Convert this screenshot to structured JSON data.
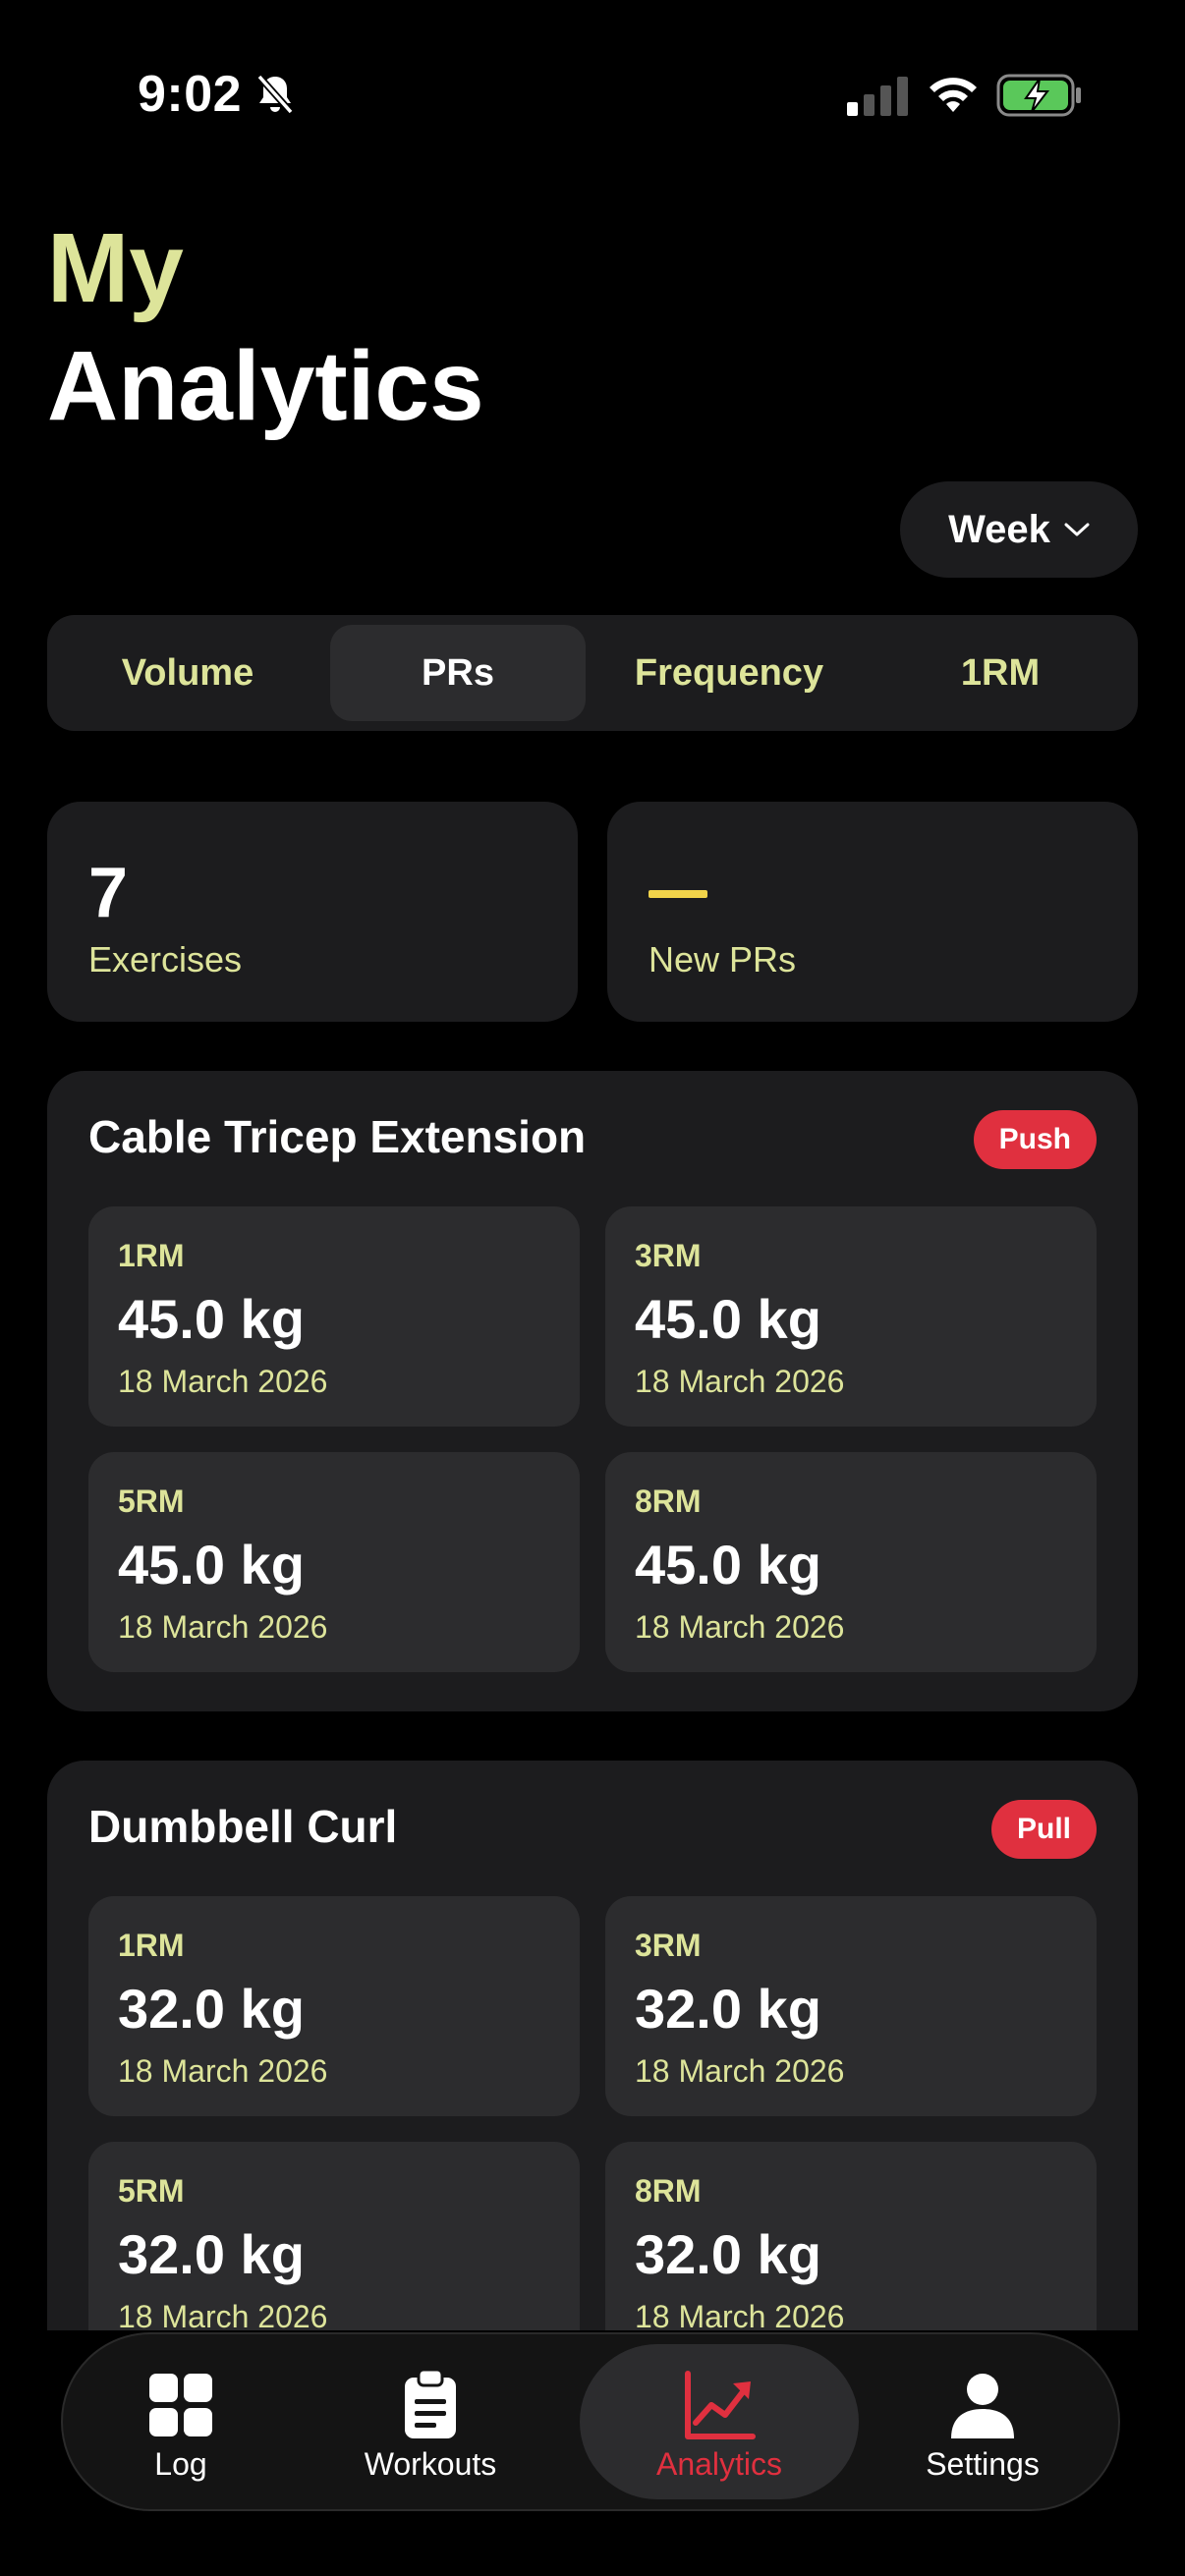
{
  "status_bar": {
    "time": "9:02"
  },
  "header": {
    "title_line1": "My",
    "title_line2": "Analytics"
  },
  "period_select": {
    "value": "Week"
  },
  "segments": [
    {
      "label": "Volume",
      "active": false
    },
    {
      "label": "PRs",
      "active": true
    },
    {
      "label": "Frequency",
      "active": false
    },
    {
      "label": "1RM",
      "active": false
    }
  ],
  "stats": {
    "exercises": {
      "value": "7",
      "label": "Exercises"
    },
    "new_prs": {
      "value": "—",
      "label": "New PRs"
    }
  },
  "exercises": [
    {
      "name": "Cable Tricep Extension",
      "badge": "Push",
      "prs": [
        {
          "label": "1RM",
          "value": "45.0 kg",
          "date": "18 March 2026"
        },
        {
          "label": "3RM",
          "value": "45.0 kg",
          "date": "18 March 2026"
        },
        {
          "label": "5RM",
          "value": "45.0 kg",
          "date": "18 March 2026"
        },
        {
          "label": "8RM",
          "value": "45.0 kg",
          "date": "18 March 2026"
        }
      ]
    },
    {
      "name": "Dumbbell Curl",
      "badge": "Pull",
      "prs": [
        {
          "label": "1RM",
          "value": "32.0 kg",
          "date": "18 March 2026"
        },
        {
          "label": "3RM",
          "value": "32.0 kg",
          "date": "18 March 2026"
        },
        {
          "label": "5RM",
          "value": "32.0 kg",
          "date": "18 March 2026"
        },
        {
          "label": "8RM",
          "value": "32.0 kg",
          "date": "18 March 2026"
        }
      ]
    }
  ],
  "tab_bar": [
    {
      "label": "Log",
      "icon": "grid-icon",
      "active": false
    },
    {
      "label": "Workouts",
      "icon": "clipboard-icon",
      "active": false
    },
    {
      "label": "Analytics",
      "icon": "chart-line-icon",
      "active": true
    },
    {
      "label": "Settings",
      "icon": "person-icon",
      "active": false
    }
  ],
  "colors": {
    "accent": "#dde49a",
    "badge": "#e0303f",
    "card": "#1c1c1e",
    "tile": "#2c2c2e",
    "dash": "#f2d44a"
  }
}
